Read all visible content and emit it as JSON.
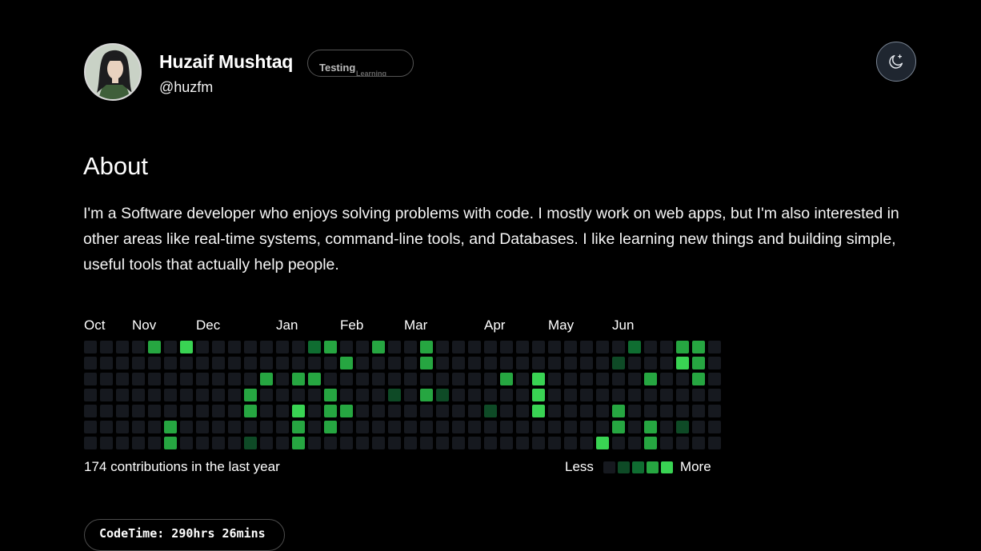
{
  "profile": {
    "name": "Huzaif Mushtaq",
    "handle": "@huzfm",
    "status": "Testing",
    "status_ghost": "Learning"
  },
  "theme_toggle": {
    "icon": "moon-stars-icon"
  },
  "about": {
    "title": "About",
    "text": "I'm a Software developer who enjoys solving problems with code. I mostly work on web apps, but I'm also interested in other areas like real-time systems, command-line tools, and Databases. I like learning new things and building simple, useful tools that actually help people."
  },
  "contributions": {
    "months": [
      "Oct",
      "Nov",
      "Dec",
      "Jan",
      "Feb",
      "Mar",
      "Apr",
      "May",
      "Jun"
    ],
    "summary": "174 contributions in the last year",
    "legend_less": "Less",
    "legend_more": "More",
    "colors": [
      "#16191f",
      "#0e4a26",
      "#0f6d31",
      "#26a641",
      "#39d353"
    ],
    "weeks": [
      [
        0,
        0,
        0,
        0,
        0,
        0,
        0
      ],
      [
        0,
        0,
        0,
        0,
        0,
        0,
        0
      ],
      [
        0,
        0,
        0,
        0,
        0,
        0,
        0
      ],
      [
        0,
        0,
        0,
        0,
        0,
        0,
        0
      ],
      [
        3,
        0,
        0,
        0,
        0,
        0,
        0
      ],
      [
        0,
        0,
        0,
        0,
        0,
        3,
        3
      ],
      [
        4,
        0,
        0,
        0,
        0,
        0,
        0
      ],
      [
        0,
        0,
        0,
        0,
        0,
        0,
        0
      ],
      [
        0,
        0,
        0,
        0,
        0,
        0,
        0
      ],
      [
        0,
        0,
        0,
        0,
        0,
        0,
        0
      ],
      [
        0,
        0,
        0,
        3,
        3,
        0,
        1
      ],
      [
        0,
        0,
        3,
        0,
        0,
        0,
        0
      ],
      [
        0,
        0,
        0,
        0,
        0,
        0,
        0
      ],
      [
        0,
        0,
        3,
        0,
        4,
        3,
        3
      ],
      [
        2,
        0,
        3,
        0,
        0,
        0,
        0
      ],
      [
        3,
        0,
        0,
        3,
        3,
        3,
        0
      ],
      [
        0,
        3,
        0,
        0,
        3,
        0,
        0
      ],
      [
        0,
        0,
        0,
        0,
        0,
        0,
        0
      ],
      [
        3,
        0,
        0,
        0,
        0,
        0,
        0
      ],
      [
        0,
        0,
        0,
        1,
        0,
        0,
        0
      ],
      [
        0,
        0,
        0,
        0,
        0,
        0,
        0
      ],
      [
        3,
        3,
        0,
        3,
        0,
        0,
        0
      ],
      [
        0,
        0,
        0,
        1,
        0,
        0,
        0
      ],
      [
        0,
        0,
        0,
        0,
        0,
        0,
        0
      ],
      [
        0,
        0,
        0,
        0,
        0,
        0,
        0
      ],
      [
        0,
        0,
        0,
        0,
        1,
        0,
        0
      ],
      [
        0,
        0,
        3,
        0,
        0,
        0,
        0
      ],
      [
        0,
        0,
        0,
        0,
        0,
        0,
        0
      ],
      [
        0,
        0,
        4,
        4,
        4,
        0,
        0
      ],
      [
        0,
        0,
        0,
        0,
        0,
        0,
        0
      ],
      [
        0,
        0,
        0,
        0,
        0,
        0,
        0
      ],
      [
        0,
        0,
        0,
        0,
        0,
        0,
        0
      ],
      [
        0,
        0,
        0,
        0,
        0,
        0,
        4
      ],
      [
        0,
        1,
        0,
        0,
        3,
        3,
        0
      ],
      [
        2,
        0,
        0,
        0,
        0,
        0,
        0
      ],
      [
        0,
        0,
        3,
        0,
        0,
        3,
        3
      ],
      [
        0,
        0,
        0,
        0,
        0,
        0,
        0
      ],
      [
        3,
        4,
        0,
        0,
        0,
        1,
        0
      ],
      [
        3,
        3,
        3,
        0,
        0,
        0,
        0
      ],
      [
        0,
        0,
        0,
        0,
        0,
        0,
        0
      ]
    ]
  },
  "codetime": {
    "label": "CodeTime: 290hrs 26mins"
  }
}
